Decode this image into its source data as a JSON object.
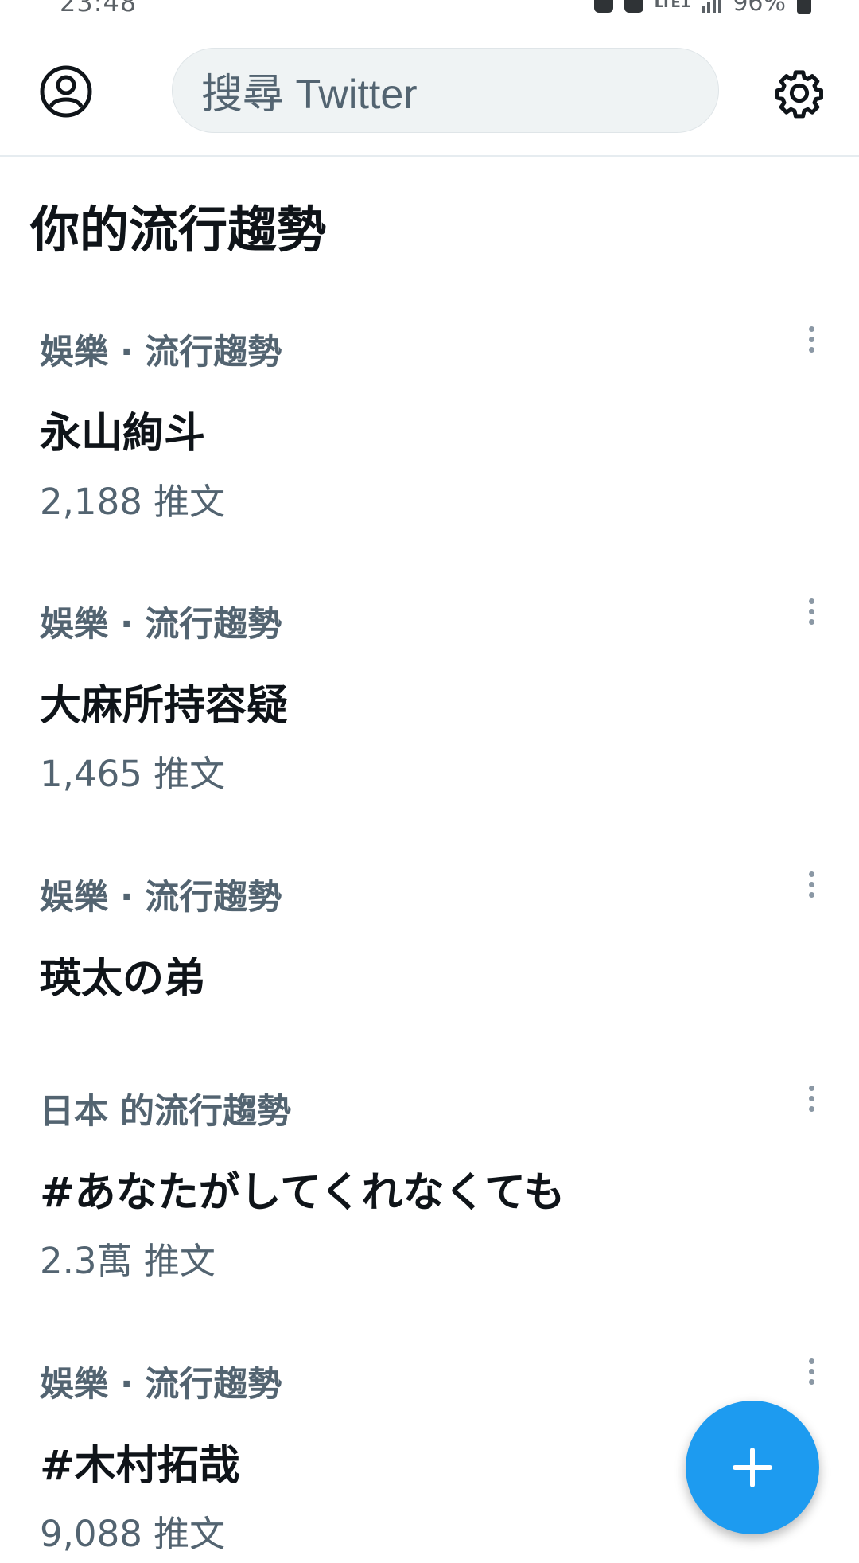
{
  "status_bar": {
    "time": "23:48",
    "network": "LTE1",
    "battery": "96%"
  },
  "header": {
    "avatar_icon": "user-circle-icon",
    "search_placeholder": "搜尋 Twitter",
    "settings_icon": "gear-icon"
  },
  "section": {
    "title": "你的流行趨勢"
  },
  "trends": [
    {
      "meta": "娛樂 · 流行趨勢",
      "name": "永山絢斗",
      "count": "2,188 推文"
    },
    {
      "meta": "娛樂 · 流行趨勢",
      "name": "大麻所持容疑",
      "count": "1,465 推文"
    },
    {
      "meta": "娛樂 · 流行趨勢",
      "name": "瑛太の弟",
      "count": ""
    },
    {
      "meta": "日本 的流行趨勢",
      "name": "#あなたがしてくれなくても",
      "count": "2.3萬 推文"
    },
    {
      "meta": "娛樂 · 流行趨勢",
      "name": "#木村拓哉",
      "count": "9,088 推文"
    }
  ],
  "fab": {
    "icon": "plus-icon",
    "color": "#1d9bf0"
  }
}
